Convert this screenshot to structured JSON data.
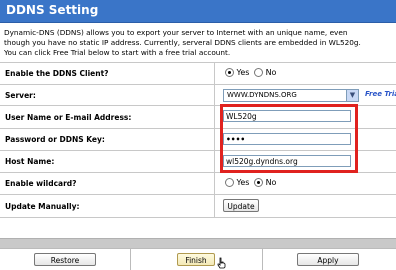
{
  "page": {
    "title": "DDNS Setting"
  },
  "description": [
    "Dynamic-DNS (DDNS) allows you to export your server to Internet with an unique name, even",
    "though you have no static IP address. Currently, serveral DDNS clients are embedded in WL520g.",
    "You can click Free Trial below to start with a free trial account."
  ],
  "form": {
    "enable_ddns": {
      "label": "Enable the DDNS Client?",
      "yes": "Yes",
      "no": "No",
      "selected": "Yes"
    },
    "server": {
      "label": "Server:",
      "value": "WWW.DYNDNS.ORG",
      "free_trial": "Free Trial"
    },
    "username": {
      "label": "User Name or E-mail Address:",
      "value": "WL520g"
    },
    "password": {
      "label": "Password or DDNS Key:",
      "value": "••••"
    },
    "hostname": {
      "label": "Host Name:",
      "value": "wl520g.dyndns.org"
    },
    "wildcard": {
      "label": "Enable wildcard?",
      "yes": "Yes",
      "no": "No",
      "selected": "No"
    },
    "update": {
      "label": "Update Manually:",
      "button": "Update"
    }
  },
  "buttons": {
    "restore": "Restore",
    "finish": "Finish",
    "apply": "Apply"
  },
  "colors": {
    "header": "#3a75c8",
    "highlight": "#e0221f",
    "link": "#2a55c8"
  }
}
